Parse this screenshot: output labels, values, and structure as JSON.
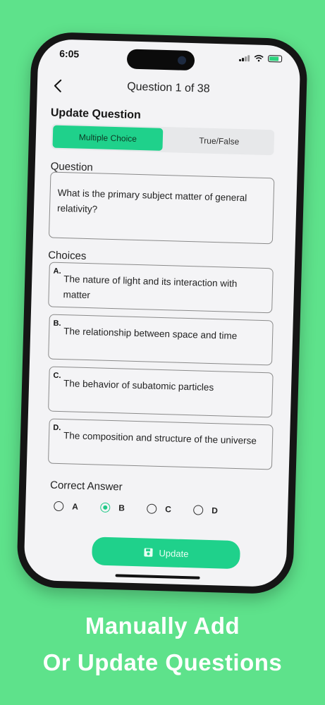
{
  "status_bar": {
    "time": "6:05"
  },
  "nav": {
    "title": "Question 1 of 38"
  },
  "form": {
    "section_title": "Update Question",
    "tabs": [
      {
        "label": "Multiple Choice",
        "active": true
      },
      {
        "label": "True/False",
        "active": false
      }
    ],
    "question_label": "Question",
    "question_value": "What is the primary subject matter of general relativity?",
    "choices_label": "Choices",
    "choices": [
      {
        "letter": "A.",
        "text": "The nature of light and its interaction with matter"
      },
      {
        "letter": "B.",
        "text": "The relationship between space and time"
      },
      {
        "letter": "C.",
        "text": "The behavior of subatomic particles"
      },
      {
        "letter": "D.",
        "text": "The composition and structure of the universe"
      }
    ],
    "correct_answer_label": "Correct Answer",
    "answer_options": [
      "A",
      "B",
      "C",
      "D"
    ],
    "selected_answer": "B",
    "update_label": "Update"
  },
  "caption": {
    "line1": "Manually Add",
    "line2": "Or Update Questions"
  },
  "colors": {
    "background": "#5ee28b",
    "accent": "#1fd18b"
  }
}
